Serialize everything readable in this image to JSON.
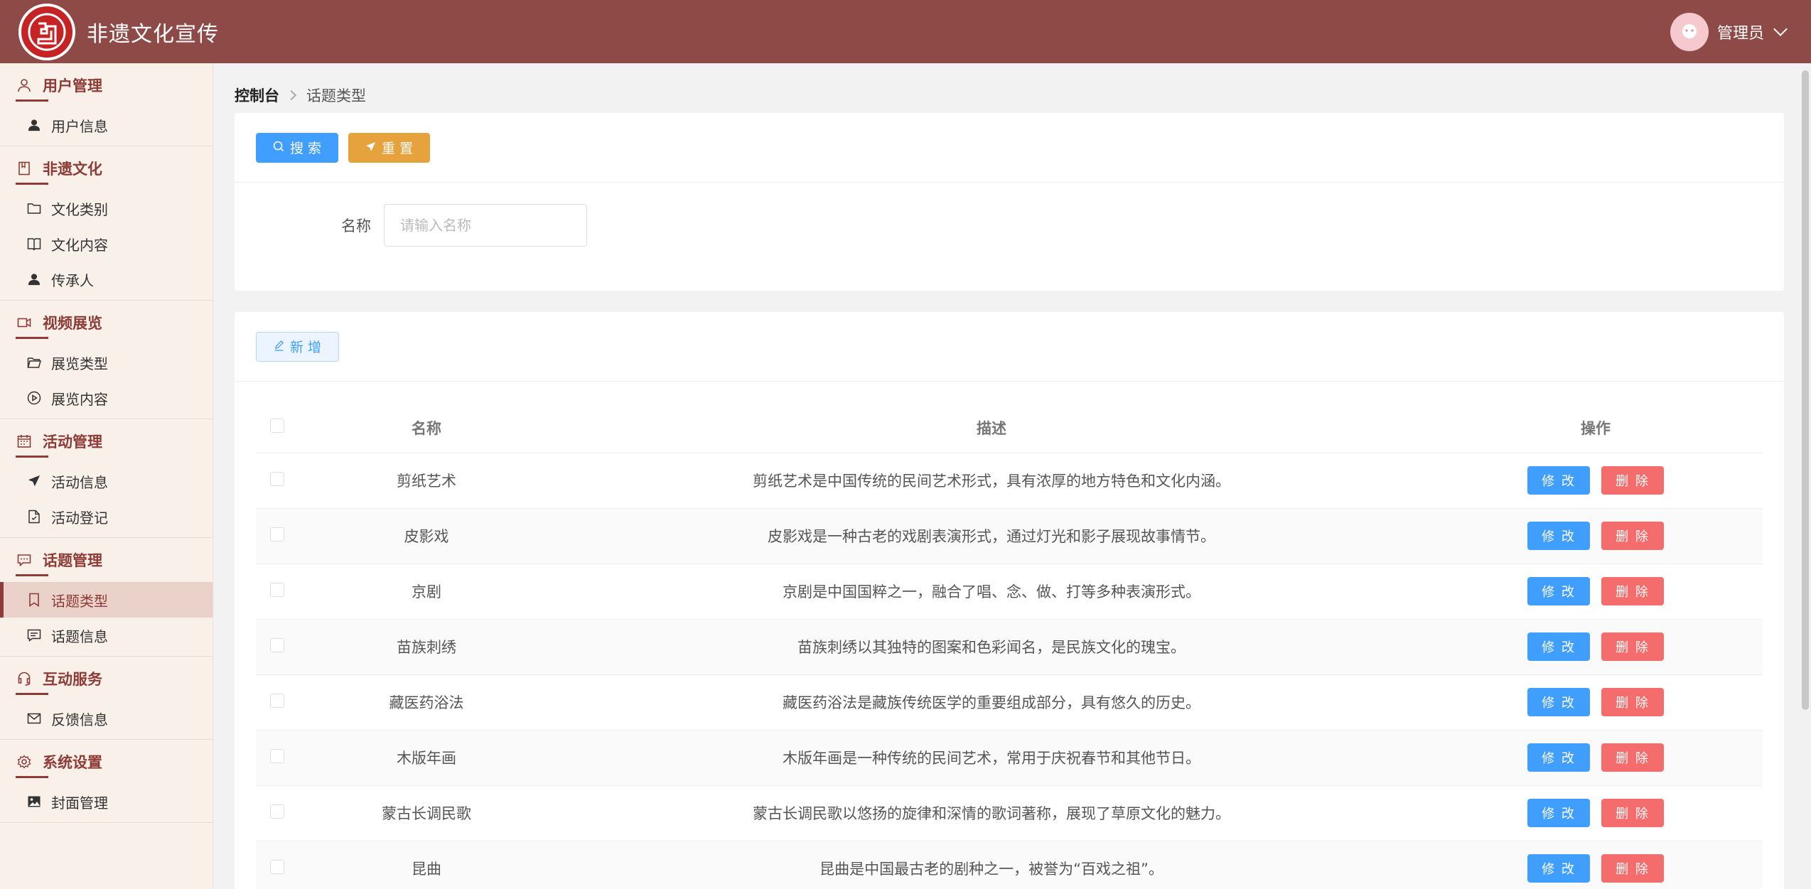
{
  "app": {
    "title": "非遗文化宣传",
    "user": "管理员"
  },
  "colors": {
    "header": "#8e4a47",
    "accent": "#8e3b36",
    "primary": "#409eff",
    "warning": "#e6a23c",
    "danger": "#f56c6c"
  },
  "sidebar": {
    "groups": [
      {
        "title": "用户管理",
        "icon": "user-icon",
        "items": [
          {
            "label": "用户信息",
            "icon": "user-filled-icon"
          }
        ]
      },
      {
        "title": "非遗文化",
        "icon": "book-icon",
        "items": [
          {
            "label": "文化类别",
            "icon": "folder-icon"
          },
          {
            "label": "文化内容",
            "icon": "open-book-icon"
          },
          {
            "label": "传承人",
            "icon": "user-filled-icon"
          }
        ]
      },
      {
        "title": "视频展览",
        "icon": "video-camera-icon",
        "items": [
          {
            "label": "展览类型",
            "icon": "folder-open-icon"
          },
          {
            "label": "展览内容",
            "icon": "play-circle-icon"
          }
        ]
      },
      {
        "title": "活动管理",
        "icon": "calendar-icon",
        "items": [
          {
            "label": "活动信息",
            "icon": "send-icon"
          },
          {
            "label": "活动登记",
            "icon": "document-icon"
          }
        ]
      },
      {
        "title": "话题管理",
        "icon": "chat-icon",
        "items": [
          {
            "label": "话题类型",
            "icon": "bookmark-icon"
          },
          {
            "label": "话题信息",
            "icon": "message-icon"
          }
        ]
      },
      {
        "title": "互动服务",
        "icon": "headset-icon",
        "items": [
          {
            "label": "反馈信息",
            "icon": "mail-icon"
          }
        ]
      },
      {
        "title": "系统设置",
        "icon": "gear-icon",
        "items": [
          {
            "label": "封面管理",
            "icon": "picture-icon"
          }
        ]
      }
    ],
    "active": "话题类型"
  },
  "breadcrumb": {
    "root": "控制台",
    "current": "话题类型"
  },
  "search": {
    "search_label": "搜 索",
    "reset_label": "重 置",
    "name_label": "名称",
    "name_placeholder": "请输入名称",
    "name_value": ""
  },
  "table": {
    "add_label": "新 增",
    "headers": {
      "name": "名称",
      "desc": "描述",
      "op": "操作"
    },
    "edit_label": "修 改",
    "delete_label": "删 除",
    "rows": [
      {
        "name": "剪纸艺术",
        "desc": "剪纸艺术是中国传统的民间艺术形式，具有浓厚的地方特色和文化内涵。"
      },
      {
        "name": "皮影戏",
        "desc": "皮影戏是一种古老的戏剧表演形式，通过灯光和影子展现故事情节。"
      },
      {
        "name": "京剧",
        "desc": "京剧是中国国粹之一，融合了唱、念、做、打等多种表演形式。"
      },
      {
        "name": "苗族刺绣",
        "desc": "苗族刺绣以其独特的图案和色彩闻名，是民族文化的瑰宝。"
      },
      {
        "name": "藏医药浴法",
        "desc": "藏医药浴法是藏族传统医学的重要组成部分，具有悠久的历史。"
      },
      {
        "name": "木版年画",
        "desc": "木版年画是一种传统的民间艺术，常用于庆祝春节和其他节日。"
      },
      {
        "name": "蒙古长调民歌",
        "desc": "蒙古长调民歌以悠扬的旋律和深情的歌词著称，展现了草原文化的魅力。"
      },
      {
        "name": "昆曲",
        "desc": "昆曲是中国最古老的剧种之一，被誉为“百戏之祖”。"
      }
    ]
  }
}
